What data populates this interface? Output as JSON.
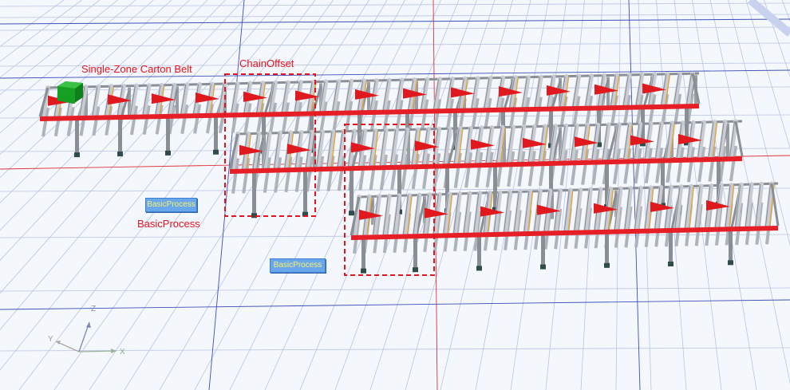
{
  "labels": {
    "belt_title": "Single-Zone Carton Belt",
    "chain_offset": "ChainOffset",
    "basic_process_label": "BasicProcess"
  },
  "blocks": {
    "basic_process_1": "BasicProcess",
    "basic_process_2": "BasicProcess"
  },
  "axis": {
    "x": "X",
    "y": "Y",
    "z": "Z"
  },
  "colors": {
    "background": "#f4f7fb",
    "grid_minor": "#b8c4e6",
    "grid_major_red": "#e0323a",
    "grid_major_blue": "#3d4fb8",
    "rail_red": "#e61e25",
    "roller": "#c9ccd2",
    "frame": "#8a8f96",
    "leg_dark": "#2f4c4a",
    "arrow": "#e0191f",
    "selection": "#e8121d",
    "carton": "#16a023",
    "block": "#6aa7ea",
    "block_text": "#f7f26a"
  },
  "icons": {
    "carton": "green-box-icon",
    "direction_arrow": "flow-arrow-icon",
    "axis_gizmo": "axis-gizmo-icon"
  }
}
